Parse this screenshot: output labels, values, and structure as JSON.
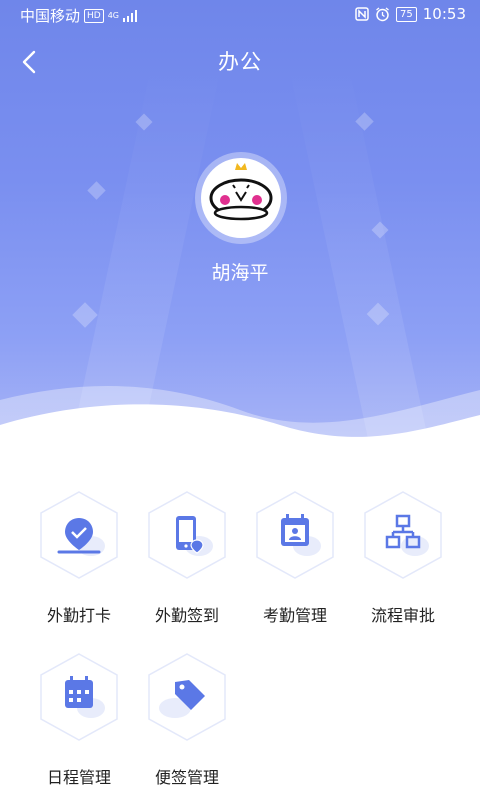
{
  "status_bar": {
    "carrier": "中国移动",
    "hd": "HD",
    "network": "4G",
    "battery": "75",
    "time": "10:53"
  },
  "header": {
    "title": "办公",
    "back_icon": "chevron-left-icon"
  },
  "profile": {
    "name": "胡海平"
  },
  "colors": {
    "accent": "#6f86ea",
    "icon": "#5b78e6"
  },
  "grid": {
    "items": [
      {
        "label": "外勤打卡",
        "icon": "location-check-icon"
      },
      {
        "label": "外勤签到",
        "icon": "phone-location-icon"
      },
      {
        "label": "考勤管理",
        "icon": "calendar-person-icon"
      },
      {
        "label": "流程审批",
        "icon": "flowchart-icon"
      },
      {
        "label": "日程管理",
        "icon": "calendar-icon"
      },
      {
        "label": "便签管理",
        "icon": "tag-icon"
      }
    ]
  }
}
